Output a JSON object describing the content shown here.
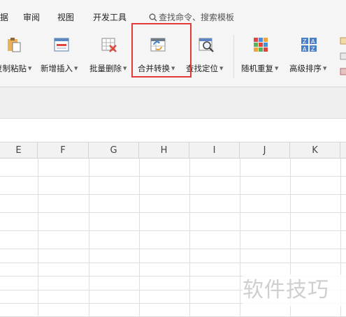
{
  "menubar": {
    "items": [
      "据",
      "审阅",
      "视图",
      "开发工具"
    ],
    "search_text": "查找命令、搜索模板"
  },
  "ribbon": {
    "tools": [
      {
        "label": "复制粘贴",
        "icon": "paste-icon"
      },
      {
        "label": "新增插入",
        "icon": "insert-icon"
      },
      {
        "label": "批量删除",
        "icon": "delete-icon"
      },
      {
        "label": "合并转换",
        "icon": "merge-convert-icon"
      },
      {
        "label": "查找定位",
        "icon": "find-locate-icon"
      },
      {
        "label": "随机重复",
        "icon": "random-repeat-icon"
      },
      {
        "label": "高级排序",
        "icon": "advanced-sort-icon"
      }
    ],
    "highlighted_tool": "合并转换"
  },
  "sheet": {
    "columns": [
      "E",
      "F",
      "G",
      "H",
      "I",
      "J",
      "K"
    ]
  },
  "watermark": "软件技巧",
  "colors": {
    "highlight": "#e23a36",
    "ribbon_bg": "#f5f5f5",
    "header_bg": "#f2f2f2"
  }
}
